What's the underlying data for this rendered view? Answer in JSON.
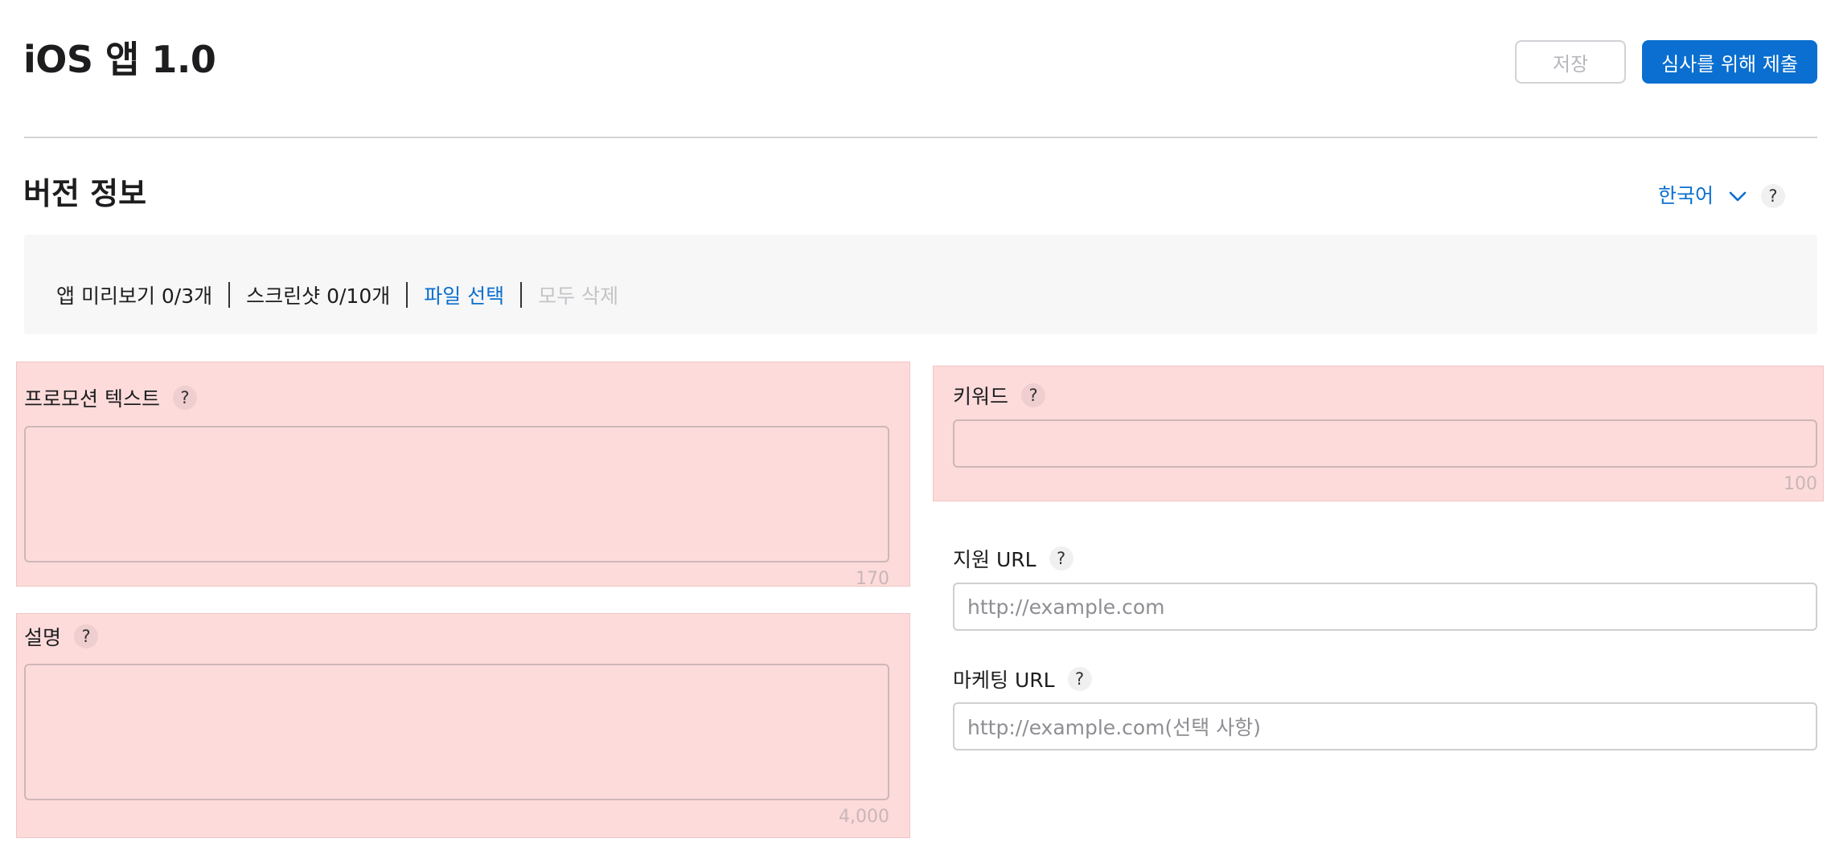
{
  "header": {
    "title": "iOS 앱 1.0",
    "save_label": "저장",
    "submit_label": "심사를 위해 제출"
  },
  "section": {
    "title": "버전 정보",
    "language": "한국어",
    "help": "?"
  },
  "media": {
    "preview": "앱 미리보기 0/3개",
    "screenshots": "스크린샷 0/10개",
    "choose_file": "파일 선택",
    "delete_all": "모두 삭제"
  },
  "fields": {
    "promo_text": {
      "label": "프로모션 텍스트",
      "help": "?",
      "value": "",
      "counter": "170"
    },
    "description": {
      "label": "설명",
      "help": "?",
      "value": "",
      "counter": "4,000"
    },
    "keywords": {
      "label": "키워드",
      "help": "?",
      "value": "",
      "counter": "100"
    },
    "support_url": {
      "label": "지원 URL",
      "help": "?",
      "value": "",
      "placeholder": "http://example.com"
    },
    "marketing_url": {
      "label": "마케팅 URL",
      "help": "?",
      "value": "",
      "placeholder": "http://example.com(선택 사항)"
    }
  },
  "colors": {
    "accent": "#0a6fd0",
    "error_background": "#fddbdb"
  },
  "icons": {
    "language_dropdown": "chevron-down-icon",
    "help": "help-icon"
  }
}
